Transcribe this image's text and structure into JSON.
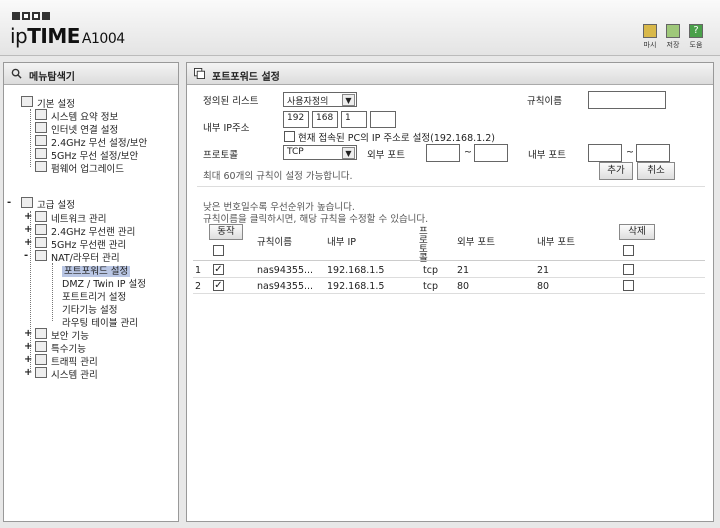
{
  "header": {
    "brand_part1": "ip",
    "brand_part2": "TIME",
    "brand_model": "A1004",
    "buttons": [
      {
        "label": "마시",
        "icon": "home-icon",
        "color": "#d8b84a"
      },
      {
        "label": "저장",
        "icon": "save-icon",
        "color": "#9fc87a"
      },
      {
        "label": "도움",
        "icon": "help-icon",
        "color": "#4aa04a"
      }
    ]
  },
  "sidebar": {
    "title": "메뉴탐색기",
    "groups": [
      {
        "label": "기본 설정",
        "items": [
          "시스템 요약 정보",
          "인터넷 연결 설정",
          "2.4GHz 무선 설정/보안",
          "5GHz 무선 설정/보안",
          "펌웨어 업그레이드"
        ]
      },
      {
        "label": "고급 설정",
        "items": [
          {
            "label": "네트워크 관리",
            "pm": "+"
          },
          {
            "label": "2.4GHz 무선랜 관리",
            "pm": "+"
          },
          {
            "label": "5GHz 무선랜 관리",
            "pm": "+"
          },
          {
            "label": "NAT/라우터 관리",
            "pm": "-",
            "children": [
              "포트포워드 설정",
              "DMZ / Twin IP 설정",
              "포트트리거 설정",
              "기타기능 설정",
              "라우팅 테이블 관리"
            ]
          },
          {
            "label": "보안 기능",
            "pm": "+"
          },
          {
            "label": "특수기능",
            "pm": "+"
          },
          {
            "label": "트래픽 관리",
            "pm": "+"
          },
          {
            "label": "시스템 관리",
            "pm": "+"
          }
        ]
      }
    ]
  },
  "main": {
    "title": "포트포워드 설정",
    "form": {
      "predefined_label": "정의된 리스트",
      "predefined_value": "사용자정의",
      "rule_name_label": "규칙이름",
      "rule_name_value": "",
      "internal_ip_label": "내부 IP주소",
      "ip_octets": [
        "192",
        "168",
        "1",
        ""
      ],
      "use_current_ip_label": "현재 접속된 PC의 IP 주소로 설정(192.168.1.2)",
      "protocol_label": "프로토콜",
      "protocol_value": "TCP",
      "external_port_label": "외부 포트",
      "internal_port_label": "내부 포트",
      "tilde": "~",
      "max_note": "최대 60개의 규칙이 설정 가능합니다.",
      "add_button": "추가",
      "cancel_button": "취소"
    },
    "notes": [
      "낮은 번호일수록 우선순위가 높습니다.",
      "규칙이름을 클릭하시면, 해당 규칙을 수정할 수 있습니다."
    ],
    "table": {
      "action_button": "동작",
      "delete_button": "삭제",
      "headers": {
        "name": "규칙이름",
        "internal_ip": "내부 IP",
        "protocol": "프로토콜",
        "external_port": "외부 포트",
        "internal_port": "내부 포트"
      },
      "rows": [
        {
          "num": "1",
          "enabled": true,
          "name": "nas94355...",
          "ip": "192.168.1.5",
          "proto": "tcp",
          "ext": "21",
          "int": "21"
        },
        {
          "num": "2",
          "enabled": true,
          "name": "nas94355...",
          "ip": "192.168.1.5",
          "proto": "tcp",
          "ext": "80",
          "int": "80"
        }
      ]
    }
  }
}
